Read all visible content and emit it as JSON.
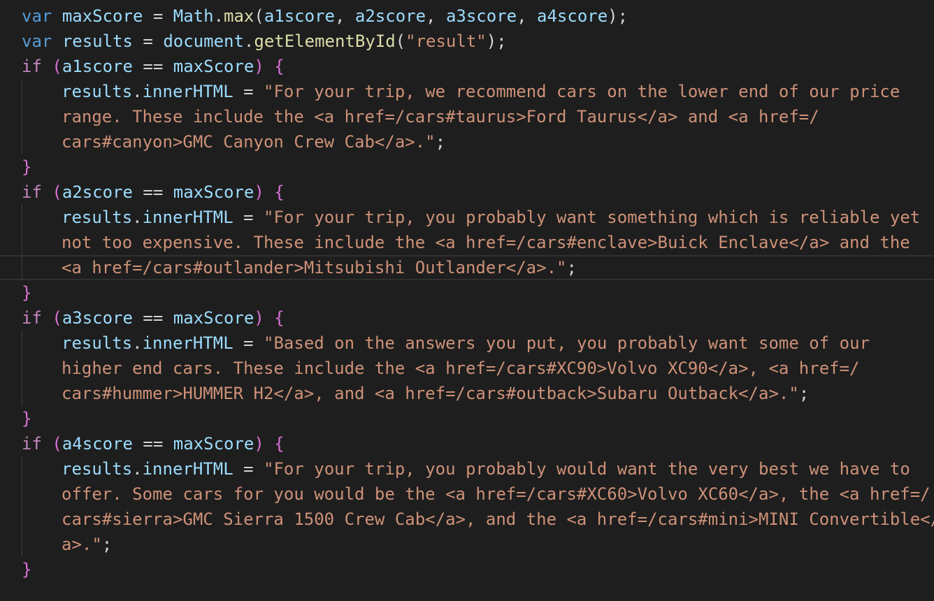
{
  "theme": {
    "background": "#1e1e1e",
    "keyword_blue": "#569cd6",
    "keyword_control": "#c586c0",
    "variable": "#9cdcfe",
    "function": "#dcdcaa",
    "string": "#ce9178",
    "bracket": "#da70d6",
    "text": "#d4d4d4"
  },
  "code": {
    "lines": [
      {
        "tokens": [
          {
            "t": "kw-blue",
            "v": "var"
          },
          {
            "t": "punc",
            "v": " "
          },
          {
            "t": "var",
            "v": "maxScore"
          },
          {
            "t": "punc",
            "v": " = "
          },
          {
            "t": "var",
            "v": "Math"
          },
          {
            "t": "punc",
            "v": "."
          },
          {
            "t": "fn",
            "v": "max"
          },
          {
            "t": "punc",
            "v": "("
          },
          {
            "t": "var",
            "v": "a1score"
          },
          {
            "t": "punc",
            "v": ", "
          },
          {
            "t": "var",
            "v": "a2score"
          },
          {
            "t": "punc",
            "v": ", "
          },
          {
            "t": "var",
            "v": "a3score"
          },
          {
            "t": "punc",
            "v": ", "
          },
          {
            "t": "var",
            "v": "a4score"
          },
          {
            "t": "punc",
            "v": ");"
          }
        ]
      },
      {
        "tokens": [
          {
            "t": "kw-blue",
            "v": "var"
          },
          {
            "t": "punc",
            "v": " "
          },
          {
            "t": "var",
            "v": "results"
          },
          {
            "t": "punc",
            "v": " = "
          },
          {
            "t": "var",
            "v": "document"
          },
          {
            "t": "punc",
            "v": "."
          },
          {
            "t": "fn",
            "v": "getElementById"
          },
          {
            "t": "punc",
            "v": "("
          },
          {
            "t": "str",
            "v": "\"result\""
          },
          {
            "t": "punc",
            "v": ");"
          }
        ]
      },
      {
        "tokens": [
          {
            "t": "kw-pink",
            "v": "if"
          },
          {
            "t": "punc",
            "v": " "
          },
          {
            "t": "paren",
            "v": "("
          },
          {
            "t": "var",
            "v": "a1score"
          },
          {
            "t": "punc",
            "v": " == "
          },
          {
            "t": "var",
            "v": "maxScore"
          },
          {
            "t": "paren",
            "v": ")"
          },
          {
            "t": "punc",
            "v": " "
          },
          {
            "t": "brace",
            "v": "{"
          }
        ]
      },
      {
        "indent": true,
        "tokens": [
          {
            "t": "var",
            "v": "results"
          },
          {
            "t": "punc",
            "v": "."
          },
          {
            "t": "var",
            "v": "innerHTML"
          },
          {
            "t": "punc",
            "v": " = "
          },
          {
            "t": "str",
            "v": "\"For your trip, we recommend cars on the lower end of our price"
          }
        ]
      },
      {
        "indent": true,
        "tokens": [
          {
            "t": "str",
            "v": "range. These include the <a href=/cars#taurus>Ford Taurus</a> and <a href=/"
          }
        ]
      },
      {
        "indent": true,
        "tokens": [
          {
            "t": "str",
            "v": "cars#canyon>GMC Canyon Crew Cab</a>.\""
          },
          {
            "t": "punc",
            "v": ";"
          }
        ]
      },
      {
        "tokens": [
          {
            "t": "brace",
            "v": "}"
          }
        ]
      },
      {
        "tokens": [
          {
            "t": "kw-pink",
            "v": "if"
          },
          {
            "t": "punc",
            "v": " "
          },
          {
            "t": "paren",
            "v": "("
          },
          {
            "t": "var",
            "v": "a2score"
          },
          {
            "t": "punc",
            "v": " == "
          },
          {
            "t": "var",
            "v": "maxScore"
          },
          {
            "t": "paren",
            "v": ")"
          },
          {
            "t": "punc",
            "v": " "
          },
          {
            "t": "brace",
            "v": "{"
          }
        ]
      },
      {
        "indent": true,
        "tokens": [
          {
            "t": "var",
            "v": "results"
          },
          {
            "t": "punc",
            "v": "."
          },
          {
            "t": "var",
            "v": "innerHTML"
          },
          {
            "t": "punc",
            "v": " = "
          },
          {
            "t": "str",
            "v": "\"For your trip, you probably want something which is reliable yet"
          }
        ]
      },
      {
        "indent": true,
        "tokens": [
          {
            "t": "str",
            "v": "not too expensive. These include the <a href=/cars#enclave>Buick Enclave</a> and the"
          }
        ]
      },
      {
        "indent": true,
        "current": true,
        "tokens": [
          {
            "t": "str",
            "v": "<a href=/cars#outlander>Mitsubishi Outlander</a>.\""
          },
          {
            "t": "punc",
            "v": ";"
          }
        ]
      },
      {
        "tokens": [
          {
            "t": "brace",
            "v": "}"
          }
        ]
      },
      {
        "tokens": [
          {
            "t": "kw-pink",
            "v": "if"
          },
          {
            "t": "punc",
            "v": " "
          },
          {
            "t": "paren",
            "v": "("
          },
          {
            "t": "var",
            "v": "a3score"
          },
          {
            "t": "punc",
            "v": " == "
          },
          {
            "t": "var",
            "v": "maxScore"
          },
          {
            "t": "paren",
            "v": ")"
          },
          {
            "t": "punc",
            "v": " "
          },
          {
            "t": "brace",
            "v": "{"
          }
        ]
      },
      {
        "indent": true,
        "tokens": [
          {
            "t": "var",
            "v": "results"
          },
          {
            "t": "punc",
            "v": "."
          },
          {
            "t": "var",
            "v": "innerHTML"
          },
          {
            "t": "punc",
            "v": " = "
          },
          {
            "t": "str",
            "v": "\"Based on the answers you put, you probably want some of our"
          }
        ]
      },
      {
        "indent": true,
        "tokens": [
          {
            "t": "str",
            "v": "higher end cars. These include the <a href=/cars#XC90>Volvo XC90</a>, <a href=/"
          }
        ]
      },
      {
        "indent": true,
        "tokens": [
          {
            "t": "str",
            "v": "cars#hummer>HUMMER H2</a>, and <a href=/cars#outback>Subaru Outback</a>.\""
          },
          {
            "t": "punc",
            "v": ";"
          }
        ]
      },
      {
        "tokens": [
          {
            "t": "brace",
            "v": "}"
          }
        ]
      },
      {
        "tokens": [
          {
            "t": "kw-pink",
            "v": "if"
          },
          {
            "t": "punc",
            "v": " "
          },
          {
            "t": "paren",
            "v": "("
          },
          {
            "t": "var",
            "v": "a4score"
          },
          {
            "t": "punc",
            "v": " == "
          },
          {
            "t": "var",
            "v": "maxScore"
          },
          {
            "t": "paren",
            "v": ")"
          },
          {
            "t": "punc",
            "v": " "
          },
          {
            "t": "brace",
            "v": "{"
          }
        ]
      },
      {
        "indent": true,
        "tokens": [
          {
            "t": "var",
            "v": "results"
          },
          {
            "t": "punc",
            "v": "."
          },
          {
            "t": "var",
            "v": "innerHTML"
          },
          {
            "t": "punc",
            "v": " = "
          },
          {
            "t": "str",
            "v": "\"For your trip, you probably would want the very best we have to"
          }
        ]
      },
      {
        "indent": true,
        "tokens": [
          {
            "t": "str",
            "v": "offer. Some cars for you would be the <a href=/cars#XC60>Volvo XC60</a>, the <a href=/"
          }
        ]
      },
      {
        "indent": true,
        "tokens": [
          {
            "t": "str",
            "v": "cars#sierra>GMC Sierra 1500 Crew Cab</a>, and the <a href=/cars#mini>MINI Convertible</"
          }
        ]
      },
      {
        "indent": true,
        "tokens": [
          {
            "t": "str",
            "v": "a>.\""
          },
          {
            "t": "punc",
            "v": ";"
          }
        ]
      },
      {
        "tokens": [
          {
            "t": "brace",
            "v": "}"
          }
        ]
      }
    ]
  }
}
